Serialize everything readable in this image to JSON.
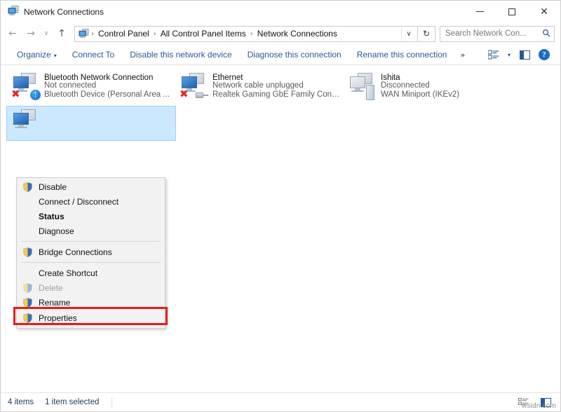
{
  "window": {
    "title": "Network Connections",
    "title_icon": "network-connections-icon",
    "minimize_label": "—",
    "maximize_label": "□",
    "close_label": "✕"
  },
  "nav": {
    "back_label": "←",
    "forward_label": "→",
    "recent_label": "∨",
    "up_label": "↑",
    "breadcrumbs": [
      {
        "label": "Control Panel"
      },
      {
        "label": "All Control Panel Items"
      },
      {
        "label": "Network Connections"
      }
    ],
    "separator": "›",
    "dropdown_label": "∨",
    "refresh_label": "↻"
  },
  "search": {
    "placeholder": "Search Network Con...",
    "value": "",
    "icon": "search-icon"
  },
  "toolbar": {
    "items": [
      {
        "label": "Organize",
        "has_caret": true
      },
      {
        "label": "Connect To",
        "has_caret": false
      },
      {
        "label": "Disable this network device",
        "has_caret": false
      },
      {
        "label": "Diagnose this connection",
        "has_caret": false
      },
      {
        "label": "Rename this connection",
        "has_caret": false
      }
    ],
    "overflow_label": "»",
    "caret_label": "▾",
    "view_icon": "view-options-icon",
    "preview_pane_icon": "preview-pane-icon",
    "help_label": "?"
  },
  "connections": [
    {
      "name": "Bluetooth Network Connection",
      "status": "Not connected",
      "device": "Bluetooth Device (Personal Area ...",
      "icon": "bluetooth-adapter-icon",
      "badge": "bluetooth",
      "error_badge": true,
      "selected": false
    },
    {
      "name": "Ethernet",
      "status": "Network cable unplugged",
      "device": "Realtek Gaming GbE Family Contr...",
      "icon": "ethernet-adapter-icon",
      "badge": "plug",
      "error_badge": true,
      "selected": false
    },
    {
      "name": "Ishita",
      "status": "Disconnected",
      "device": "WAN Miniport (IKEv2)",
      "icon": "vpn-adapter-icon",
      "badge": "tower",
      "error_badge": false,
      "selected": false
    },
    {
      "name": "",
      "status": "",
      "device": "",
      "icon": "wifi-adapter-icon",
      "badge": "none",
      "error_badge": false,
      "selected": true
    }
  ],
  "context_menu": {
    "items": [
      {
        "label": "Disable",
        "shield": true,
        "bold": false,
        "disabled": false,
        "separator_after": false
      },
      {
        "label": "Connect / Disconnect",
        "shield": false,
        "bold": false,
        "disabled": false,
        "separator_after": false
      },
      {
        "label": "Status",
        "shield": false,
        "bold": true,
        "disabled": false,
        "separator_after": false
      },
      {
        "label": "Diagnose",
        "shield": false,
        "bold": false,
        "disabled": false,
        "separator_after": true
      },
      {
        "label": "Bridge Connections",
        "shield": true,
        "bold": false,
        "disabled": false,
        "separator_after": true
      },
      {
        "label": "Create Shortcut",
        "shield": false,
        "bold": false,
        "disabled": false,
        "separator_after": false
      },
      {
        "label": "Delete",
        "shield": true,
        "bold": false,
        "disabled": true,
        "separator_after": false
      },
      {
        "label": "Rename",
        "shield": true,
        "bold": false,
        "disabled": false,
        "separator_after": false
      },
      {
        "label": "Properties",
        "shield": true,
        "bold": false,
        "disabled": false,
        "separator_after": false
      }
    ],
    "highlighted_item": "Properties",
    "highlight_color": "#e81b1b"
  },
  "statusbar": {
    "item_count": "4 items",
    "selection": "1 item selected",
    "details_view_icon": "details-view-icon",
    "large_icons_view_icon": "large-icons-view-icon"
  },
  "watermark": {
    "text": "wsidn.com"
  },
  "colors": {
    "accent": "#2b5797",
    "selection": "#cce8ff",
    "highlight": "#e81b1b",
    "link": "#2b5797"
  }
}
